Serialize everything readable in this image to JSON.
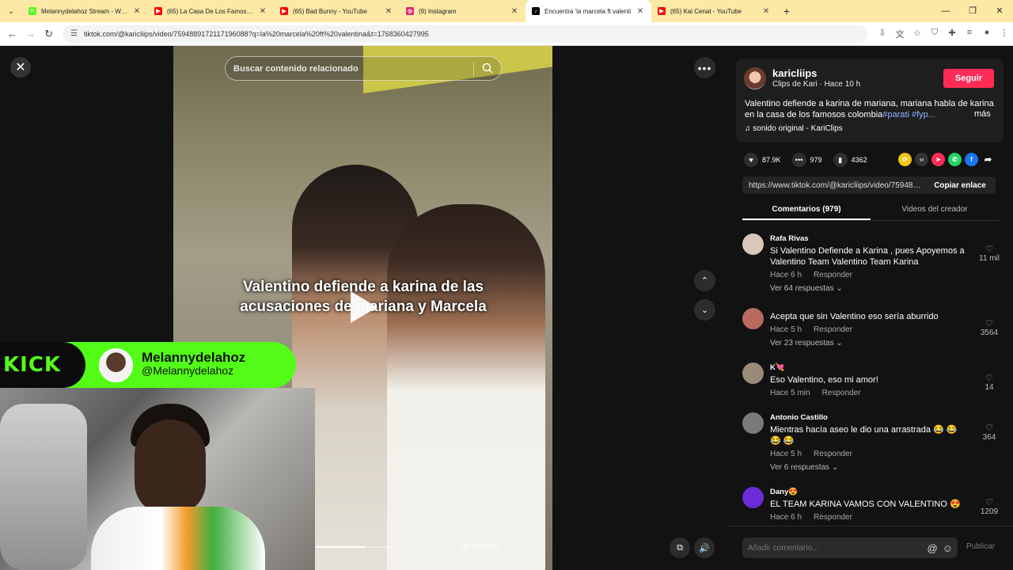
{
  "browser": {
    "tabs": [
      {
        "title": "Melannydelahoz Stream - Watc",
        "fav_color": "#53fc18",
        "fav_text": "K"
      },
      {
        "title": "(65) La Casa De Los Famosos C",
        "fav_color": "#ff0000",
        "fav_text": "▶"
      },
      {
        "title": "(65) Bad Bunny - YouTube",
        "fav_color": "#ff0000",
        "fav_text": "▶"
      },
      {
        "title": "(9) Instagram",
        "fav_color": "#d62976",
        "fav_text": "◎"
      },
      {
        "title": "Encuentra 'la marcela ft valenti",
        "fav_color": "#000000",
        "fav_text": "♪"
      },
      {
        "title": "(65) Kai Cenat - YouTube",
        "fav_color": "#ff0000",
        "fav_text": "▶"
      }
    ],
    "active_tab": 4,
    "url": "tiktok.com/@karicliips/video/7594889172117196088?q=la%20marcela%20ft%20valentina&t=1768360427995"
  },
  "video": {
    "search_placeholder": "Buscar contenido relacionado",
    "overlay_text": "Valentino defiende a karina de las acusaciones de mariana y Marcela",
    "time": "00:13/00:35",
    "progress": 0.37
  },
  "stream_overlay": {
    "logo": "KICK",
    "name": "Melannydelahoz",
    "handle": "@Melannydelahoz"
  },
  "post": {
    "author": "karicliips",
    "subtitle": "Clips de Kari · Hace 10 h",
    "follow_label": "Seguir",
    "description": "Valentino defiende a karina de mariana, mariana habla de karina en la casa de los famosos colombia",
    "hashtags": "#parati #fyp...",
    "more_label": "más",
    "sound": "sonido original - KariClips",
    "likes": "87.9K",
    "comments": "979",
    "saves": "4362",
    "link": "https://www.tiktok.com/@karicliips/video/7594889172117196088",
    "copy_label": "Copiar enlace"
  },
  "tabs": {
    "comments": "Comentarios (979)",
    "creator": "Videos del creador"
  },
  "comments": [
    {
      "user": "Rafa Rivas",
      "text": "Si Valentino Defiende a Karina , pues Apoyemos a Valentino Team Valentino Team Karina",
      "time": "Hace 6 h",
      "reply": "Responder",
      "replies": "Ver 64 respuestas ⌄",
      "likes": "11 mil",
      "avatar": "#d9c7bb"
    },
    {
      "user": "",
      "text": "Acepta que sin Valentino eso sería aburrido",
      "time": "Hace 5 h",
      "reply": "Responder",
      "replies": "Ver 23 respuestas ⌄",
      "likes": "3564",
      "avatar": "#b86a5e"
    },
    {
      "user": "K💘",
      "text": "Eso Valentino, eso mi amor!",
      "time": "Hace 5 min",
      "reply": "Responder",
      "replies": "",
      "likes": "14",
      "avatar": "#9a8a7a"
    },
    {
      "user": "Antonio Castillo",
      "text": "Mientras hacía aseo le dio una arrastrada 😂 😂 😂 😂",
      "time": "Hace 5 h",
      "reply": "Responder",
      "replies": "Ver 6 respuestas ⌄",
      "likes": "364",
      "avatar": "#7a7a7a"
    },
    {
      "user": "Dany😍",
      "text": "EL TEAM KARINA VAMOS CON VALENTINO 😍",
      "time": "Hace 6 h",
      "reply": "Responder",
      "replies": "Ver 3 respuestas ⌄",
      "likes": "1209",
      "avatar": "#6a2bd9"
    }
  ],
  "comment_input": {
    "placeholder": "Añadir comentario...",
    "publish_label": "Publicar"
  }
}
